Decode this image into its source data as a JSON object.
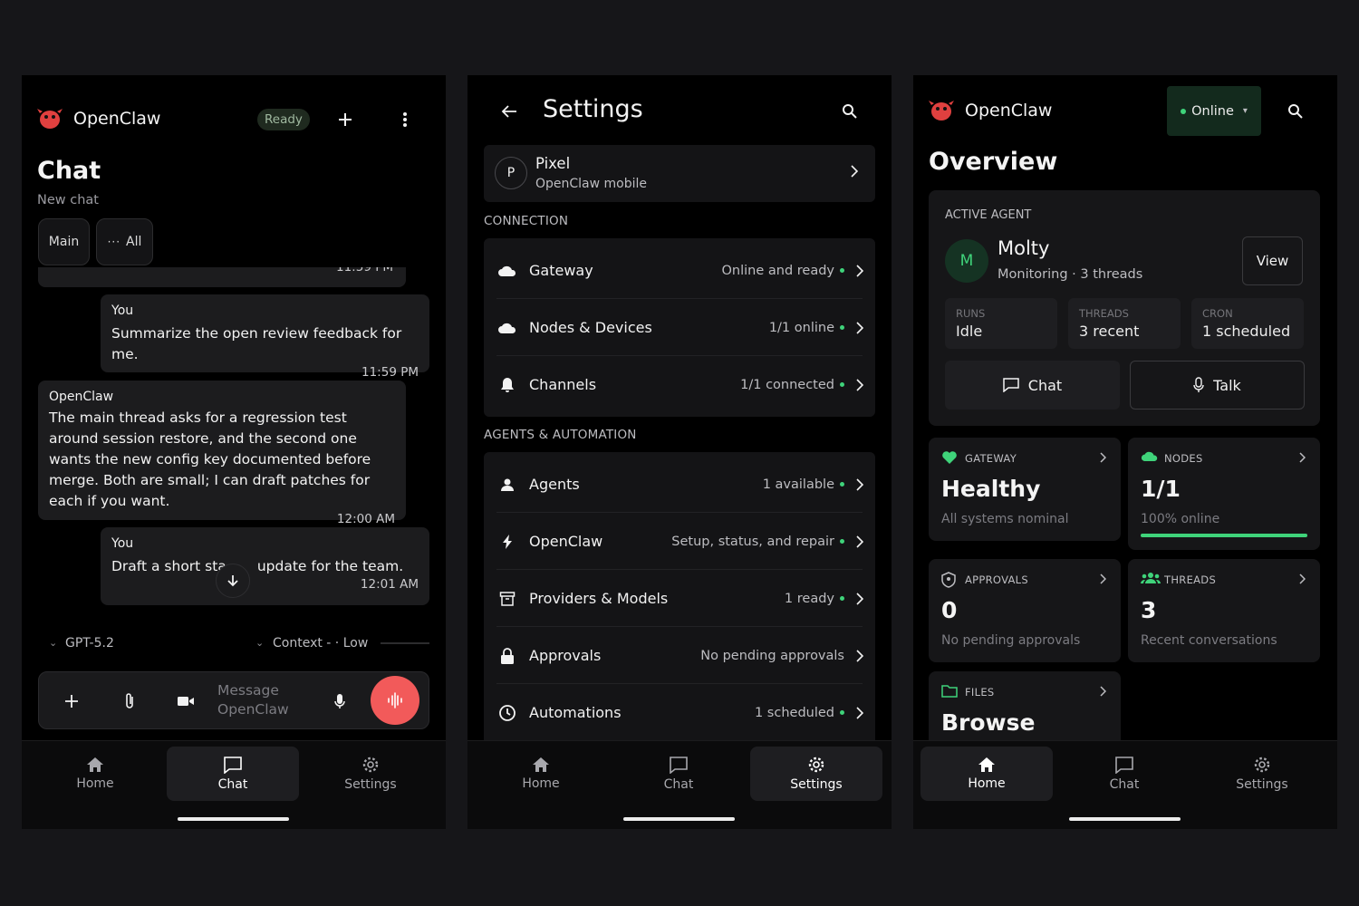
{
  "chat_screen": {
    "app_name": "OpenClaw",
    "status_badge": "Ready",
    "title": "Chat",
    "subtitle": "New chat",
    "session_chips": [
      {
        "label": "Main"
      },
      {
        "label": "All"
      }
    ],
    "clipped_time": "11:59 PM",
    "messages": [
      {
        "sender": "You",
        "text": "Summarize the open review feedback for me.",
        "time": "11:59 PM"
      },
      {
        "sender": "OpenClaw",
        "text": "The main thread asks for a regression test around session restore, and the second one wants the new config key documented before merge. Both are small; I can draft patches for each if you want.",
        "time": "12:00 AM"
      },
      {
        "sender": "You",
        "text": "Draft a short sta",
        "text_after": "update for the team.",
        "time": "12:01 AM"
      }
    ],
    "model": "GPT-5.2",
    "context": "Context - · Low",
    "composer_placeholder": "Message OpenClaw"
  },
  "settings_screen": {
    "title": "Settings",
    "device": {
      "initial": "P",
      "name": "Pixel",
      "subtitle": "OpenClaw mobile"
    },
    "sections": [
      {
        "heading": "CONNECTION",
        "rows": [
          {
            "icon": "cloud-icon",
            "label": "Gateway",
            "status": "Online and ready",
            "dot": true
          },
          {
            "icon": "cloud-icon",
            "label": "Nodes & Devices",
            "status": "1/1 online",
            "dot": true
          },
          {
            "icon": "bell-icon",
            "label": "Channels",
            "status": "1/1 connected",
            "dot": true
          }
        ]
      },
      {
        "heading": "AGENTS & AUTOMATION",
        "rows": [
          {
            "icon": "person-icon",
            "label": "Agents",
            "status": "1 available",
            "dot": true
          },
          {
            "icon": "bolt-icon",
            "label": "OpenClaw",
            "status": "Setup, status, and repair",
            "dot": true
          },
          {
            "icon": "archive-icon",
            "label": "Providers & Models",
            "status": "1 ready",
            "dot": true
          },
          {
            "icon": "lock-icon",
            "label": "Approvals",
            "status": "No pending approvals",
            "dot": false
          },
          {
            "icon": "clock-icon",
            "label": "Automations",
            "status": "1 scheduled",
            "dot": true
          }
        ]
      }
    ]
  },
  "overview_screen": {
    "app_name": "OpenClaw",
    "status_dropdown": "Online",
    "title": "Overview",
    "active_agent": {
      "caption": "ACTIVE AGENT",
      "initial": "M",
      "name": "Molty",
      "subtitle": "Monitoring · 3 threads",
      "view_label": "View",
      "stats": [
        {
          "caption": "RUNS",
          "value": "Idle"
        },
        {
          "caption": "THREADS",
          "value": "3 recent"
        },
        {
          "caption": "CRON",
          "value": "1 scheduled"
        }
      ],
      "chat_label": "Chat",
      "talk_label": "Talk"
    },
    "tiles": {
      "gateway": {
        "caption": "GATEWAY",
        "value": "Healthy",
        "sub": "All systems nominal"
      },
      "nodes": {
        "caption": "NODES",
        "value": "1/1",
        "sub": "100% online",
        "progress": 1.0
      },
      "approvals": {
        "caption": "APPROVALS",
        "value": "0",
        "sub": "No pending approvals"
      },
      "threads": {
        "caption": "THREADS",
        "value": "3",
        "sub": "Recent conversations"
      },
      "files": {
        "caption": "FILES",
        "value": "Browse"
      }
    }
  },
  "bottom_nav": [
    {
      "label": "Home"
    },
    {
      "label": "Chat"
    },
    {
      "label": "Settings"
    }
  ],
  "colors": {
    "accent_red": "#F25A5A",
    "green": "#3FD37A",
    "surface": "#141416",
    "background": "#000000"
  }
}
